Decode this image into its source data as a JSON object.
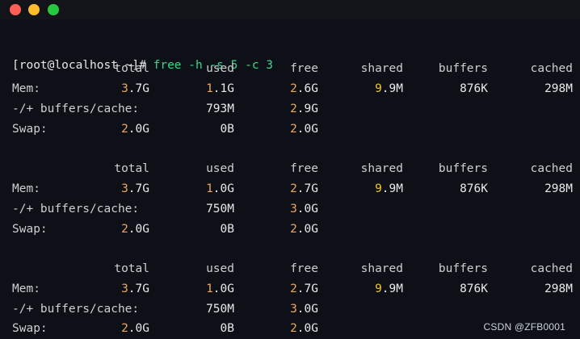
{
  "window": {
    "controls": [
      "close",
      "minimize",
      "maximize"
    ]
  },
  "terminal": {
    "prompt": "[root@localhost ~]# ",
    "command": "free -h -s 5 -c 3",
    "headers": [
      "total",
      "used",
      "free",
      "shared",
      "buffers",
      "cached"
    ],
    "blocks": [
      {
        "mem": {
          "label": "Mem:",
          "total_lead": "3",
          "total_rest": ".7G",
          "used_lead": "1",
          "used_rest": ".1G",
          "free_lead": "2",
          "free_rest": ".6G",
          "shared_lead": "9",
          "shared_rest": ".9M",
          "buffers": "876K",
          "cached": "298M"
        },
        "bufcache": {
          "label": "-/+ buffers/cache:",
          "used": "793M",
          "free_lead": "2",
          "free_rest": ".9G"
        },
        "swap": {
          "label": "Swap:",
          "total_lead": "2",
          "total_rest": ".0G",
          "used": "0B",
          "free_lead": "2",
          "free_rest": ".0G"
        }
      },
      {
        "mem": {
          "label": "Mem:",
          "total_lead": "3",
          "total_rest": ".7G",
          "used_lead": "1",
          "used_rest": ".0G",
          "free_lead": "2",
          "free_rest": ".7G",
          "shared_lead": "9",
          "shared_rest": ".9M",
          "buffers": "876K",
          "cached": "298M"
        },
        "bufcache": {
          "label": "-/+ buffers/cache:",
          "used": "750M",
          "free_lead": "3",
          "free_rest": ".0G"
        },
        "swap": {
          "label": "Swap:",
          "total_lead": "2",
          "total_rest": ".0G",
          "used": "0B",
          "free_lead": "2",
          "free_rest": ".0G"
        }
      },
      {
        "mem": {
          "label": "Mem:",
          "total_lead": "3",
          "total_rest": ".7G",
          "used_lead": "1",
          "used_rest": ".0G",
          "free_lead": "2",
          "free_rest": ".7G",
          "shared_lead": "9",
          "shared_rest": ".9M",
          "buffers": "876K",
          "cached": "298M"
        },
        "bufcache": {
          "label": "-/+ buffers/cache:",
          "used": "750M",
          "free_lead": "3",
          "free_rest": ".0G"
        },
        "swap": {
          "label": "Swap:",
          "total_lead": "2",
          "total_rest": ".0G",
          "used": "0B",
          "free_lead": "2",
          "free_rest": ".0G"
        }
      }
    ]
  },
  "watermark": "CSDN @ZFB0001",
  "colors": {
    "background": "#0d1117",
    "titlebar": "#131419",
    "command": "#3dd68c",
    "number_orange": "#f0a45d",
    "number_yellow": "#f4c430",
    "close": "#ff5f57",
    "minimize": "#febc2e",
    "maximize": "#28c840"
  }
}
